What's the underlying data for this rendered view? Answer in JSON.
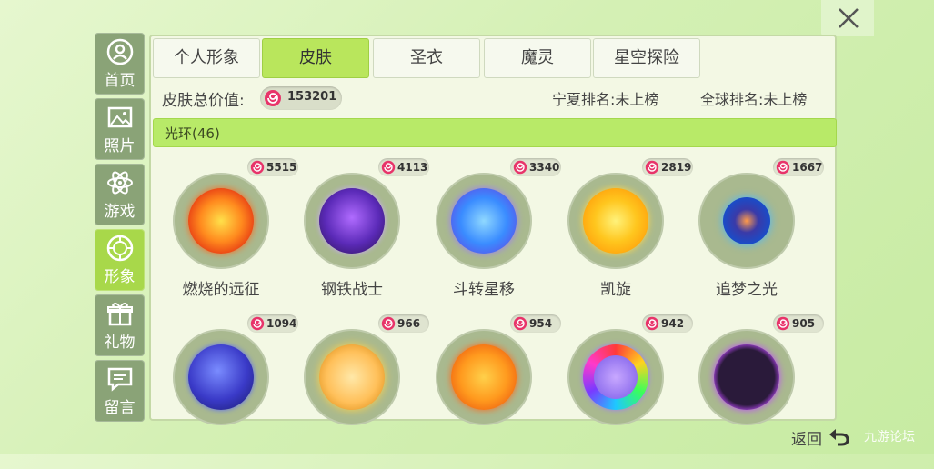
{
  "colors": {
    "accent": "#b9e65c",
    "sidebar": "#8aa377",
    "panel": "#f3f8e4"
  },
  "close": {
    "icon": "close-icon"
  },
  "sidebar": {
    "items": [
      {
        "label": "首页",
        "icon": "user-icon",
        "active": false
      },
      {
        "label": "照片",
        "icon": "photo-icon",
        "active": false
      },
      {
        "label": "游戏",
        "icon": "atom-icon",
        "active": false
      },
      {
        "label": "形象",
        "icon": "gem-icon",
        "active": true
      },
      {
        "label": "礼物",
        "icon": "gift-icon",
        "active": false
      },
      {
        "label": "留言",
        "icon": "chat-icon",
        "active": false
      }
    ]
  },
  "tabs": [
    {
      "label": "个人形象",
      "active": false
    },
    {
      "label": "皮肤",
      "active": true
    },
    {
      "label": "圣衣",
      "active": false
    },
    {
      "label": "魔灵",
      "active": false
    },
    {
      "label": "星空探险",
      "active": false
    }
  ],
  "stats": {
    "total_label": "皮肤总价值:",
    "total_value": "153201",
    "rank_ningxia": "宁夏排名:未上榜",
    "rank_global": "全球排名:未上榜"
  },
  "category": {
    "label": "光环(46)"
  },
  "items": [
    {
      "name": "燃烧的远征",
      "price": "5515"
    },
    {
      "name": "钢铁战士",
      "price": "4113"
    },
    {
      "name": "斗转星移",
      "price": "3340"
    },
    {
      "name": "凯旋",
      "price": "2819"
    },
    {
      "name": "追梦之光",
      "price": "1667"
    },
    {
      "name": "",
      "price": "1094"
    },
    {
      "name": "",
      "price": "966"
    },
    {
      "name": "",
      "price": "954"
    },
    {
      "name": "",
      "price": "942"
    },
    {
      "name": "",
      "price": "905"
    }
  ],
  "back": {
    "label": "返回"
  },
  "watermark": "九游论坛"
}
